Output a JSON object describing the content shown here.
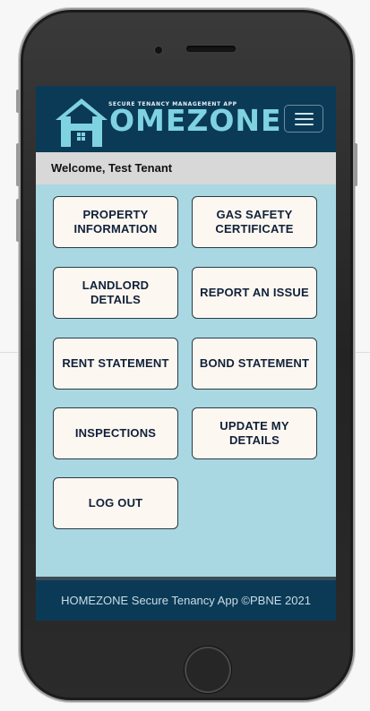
{
  "app": {
    "logo_tagline": "SECURE TENANCY MANAGEMENT APP",
    "logo_word": "OMEZONE",
    "logo_icon": "house-h-icon",
    "menu_icon": "hamburger-icon"
  },
  "welcome": {
    "text": "Welcome, Test Tenant"
  },
  "tiles": [
    {
      "label": "PROPERTY INFORMATION"
    },
    {
      "label": "GAS SAFETY CERTIFICATE"
    },
    {
      "label": "LANDLORD DETAILS"
    },
    {
      "label": "REPORT AN ISSUE"
    },
    {
      "label": "RENT STATEMENT"
    },
    {
      "label": "BOND STATEMENT"
    },
    {
      "label": "INSPECTIONS"
    },
    {
      "label": "UPDATE MY DETAILS"
    },
    {
      "label": "LOG OUT"
    }
  ],
  "footer": {
    "text": "HOMEZONE Secure Tenancy App ©PBNE 2021"
  },
  "colors": {
    "header_bg": "#0b3a57",
    "body_bg": "#a9d8e3",
    "tile_bg": "#fcf7f0",
    "logo_accent": "#7fd3e0"
  }
}
